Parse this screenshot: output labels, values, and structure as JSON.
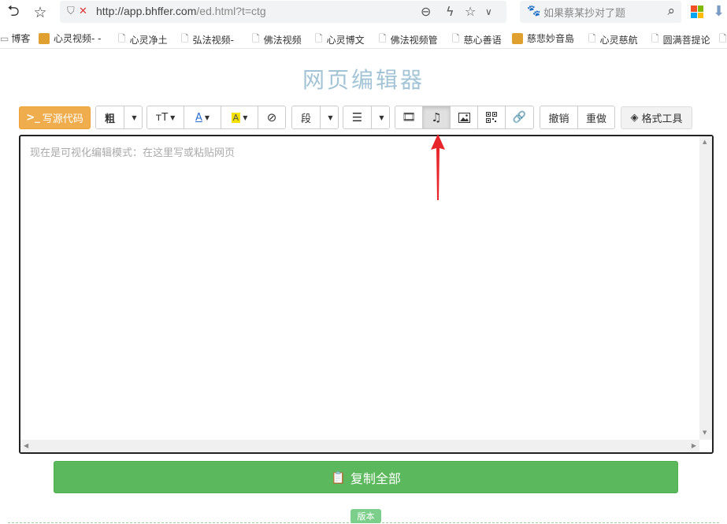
{
  "browser": {
    "url_host": "http://app.bhffer.com",
    "url_path": "/ed.html?t=ctg",
    "search_placeholder": "如果蔡某抄对了题"
  },
  "bookmarks": [
    {
      "label": "博客",
      "icon": "folder-icon"
    },
    {
      "label": "心灵视频- -",
      "icon": "favicon-image"
    },
    {
      "label": "心灵净土",
      "icon": "page-icon"
    },
    {
      "label": "弘法视频-",
      "icon": "page-icon"
    },
    {
      "label": "佛法视频",
      "icon": "page-icon"
    },
    {
      "label": "心灵博文",
      "icon": "page-icon"
    },
    {
      "label": "佛法视频管",
      "icon": "page-icon"
    },
    {
      "label": "慈心善语",
      "icon": "page-icon"
    },
    {
      "label": "慈悲妙音島",
      "icon": "favicon-image"
    },
    {
      "label": "心灵慈航",
      "icon": "page-icon"
    },
    {
      "label": "圆满菩提论",
      "icon": "page-icon"
    }
  ],
  "page": {
    "title": "网页编辑器"
  },
  "toolbar": {
    "source_button": "写源代码",
    "source_prompt": ">_",
    "bold": "粗",
    "paragraph": "段",
    "undo": "撤销",
    "redo": "重做",
    "format_tools": "格式工具"
  },
  "editor": {
    "placeholder": "现在是可视化编辑模式：在这里写或粘贴网页"
  },
  "copy_button": "复制全部",
  "version_badge": "版本",
  "colors": {
    "accent_orange": "#f0ad4e",
    "accent_green": "#5cb85c",
    "title_blue": "#a3c4d6",
    "arrow_red": "#e8252a"
  }
}
